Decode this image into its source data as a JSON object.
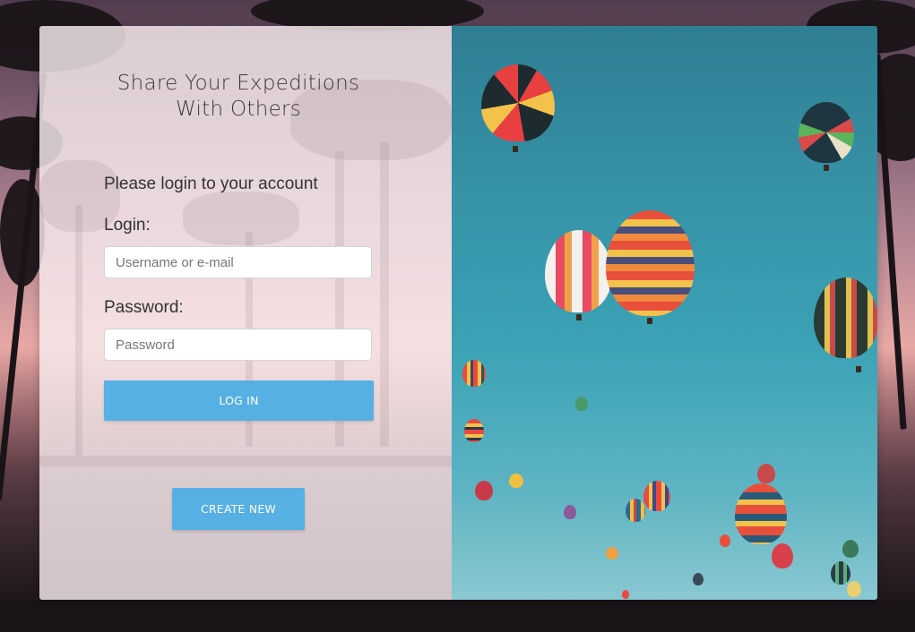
{
  "heading": {
    "line1": "Share Your Expeditions",
    "line2": "With Others"
  },
  "subtitle": "Please login to your account",
  "login": {
    "label": "Login:",
    "placeholder": "Username or e-mail"
  },
  "password": {
    "label": "Password:",
    "placeholder": "Password"
  },
  "buttons": {
    "login": "LOG IN",
    "create": "CREATE NEW"
  },
  "colors": {
    "accent": "#56b0e3"
  }
}
